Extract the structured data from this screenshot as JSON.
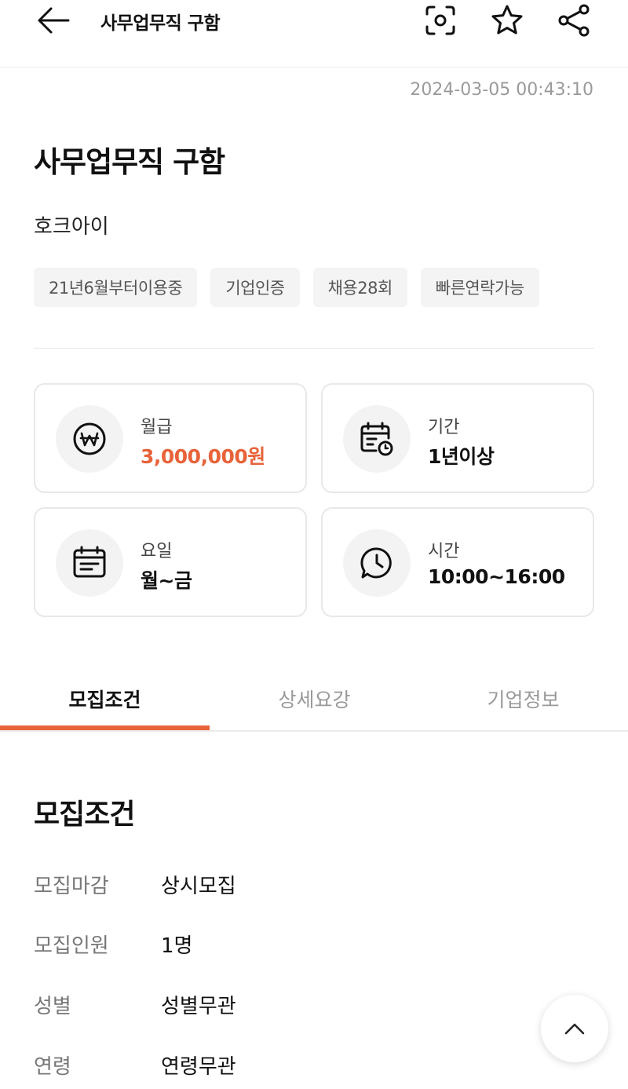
{
  "header": {
    "title": "사무업무직 구함",
    "icons": [
      "back-arrow-icon",
      "scan-icon",
      "star-icon",
      "share-icon"
    ]
  },
  "timestamp": "2024-03-05 00:43:10",
  "job": {
    "title": "사무업무직 구함",
    "company": "호크아이",
    "tags": [
      "21년6월부터이용중",
      "기업인증",
      "채용28회",
      "빠른연락가능"
    ]
  },
  "info_cards": [
    {
      "label": "월급",
      "value": "3,000,000원",
      "icon": "won-icon"
    },
    {
      "label": "기간",
      "value": "1년이상",
      "icon": "calendar-clock-icon"
    },
    {
      "label": "요일",
      "value": "월~금",
      "icon": "calendar-icon"
    },
    {
      "label": "시간",
      "value": "10:00~16:00",
      "icon": "clock-chat-icon"
    }
  ],
  "tabs": [
    "모집조건",
    "상세요강",
    "기업정보"
  ],
  "active_tab": "모집조건",
  "conditions": {
    "title": "모집조건",
    "rows": [
      {
        "key": "모집마감",
        "value": "상시모집"
      },
      {
        "key": "모집인원",
        "value": "1명"
      },
      {
        "key": "성별",
        "value": "성별무관"
      },
      {
        "key": "연령",
        "value": "연령무관"
      }
    ]
  },
  "colors": {
    "accent": "#e8633a",
    "muted": "#999999",
    "border": "#e8e8e8"
  }
}
